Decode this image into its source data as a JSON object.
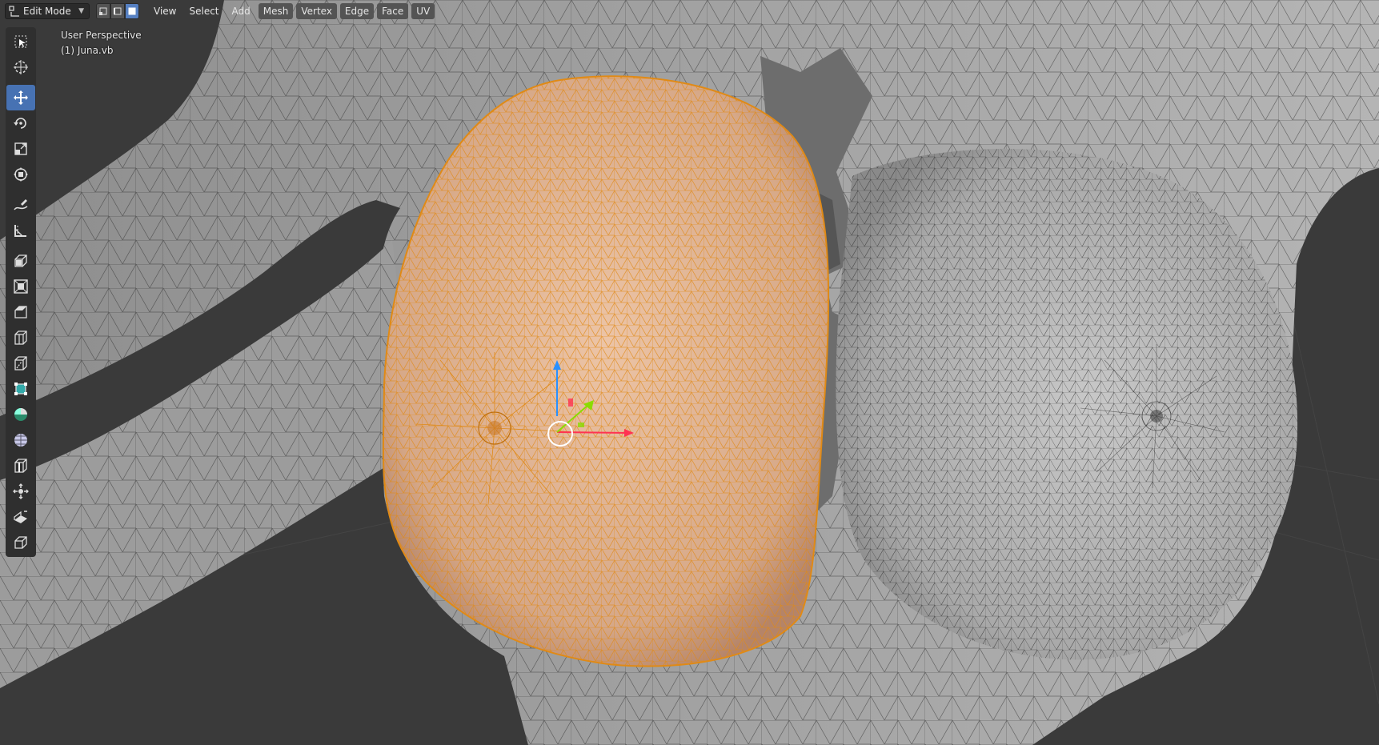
{
  "header": {
    "mode": "Edit Mode",
    "menus": [
      "View",
      "Select",
      "Add",
      "Mesh",
      "Vertex",
      "Edge",
      "Face",
      "UV"
    ],
    "select_modes": [
      "vertex-select-icon",
      "edge-select-icon",
      "face-select-icon"
    ],
    "active_select_mode": "face"
  },
  "viewport": {
    "view_name": "User Perspective",
    "object_name": "(1) Juna.vb"
  },
  "toolbar": {
    "tools": [
      "select-box-icon",
      "cursor-icon",
      "move-icon",
      "rotate-icon",
      "scale-icon",
      "transform-icon",
      "annotate-icon",
      "measure-icon",
      "extrude-region-icon",
      "inset-faces-icon",
      "bevel-icon",
      "loop-cut-icon",
      "knife-icon",
      "poly-build-icon",
      "spin-icon",
      "smooth-icon",
      "edge-slide-icon",
      "shrink-fatten-icon",
      "shear-icon",
      "rip-region-icon"
    ],
    "active_tool": "move-icon"
  },
  "colors": {
    "background": "#3a3a3a",
    "mesh": "#b8b8b8",
    "wire": "#2a2a2a",
    "selected_face": "#e0b08e",
    "selected_wire": "#e08a16",
    "active_tool": "#4772b3",
    "gizmo_x": "#ff3352",
    "gizmo_y": "#8bdc00",
    "gizmo_z": "#2890ff"
  }
}
